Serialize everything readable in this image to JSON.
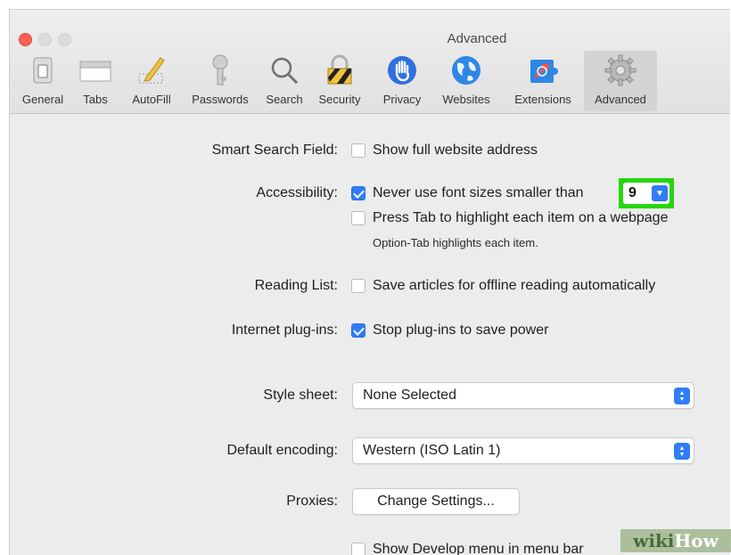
{
  "window": {
    "title": "Advanced"
  },
  "toolbar": {
    "items": [
      {
        "label": "General",
        "icon": "general-switch-icon"
      },
      {
        "label": "Tabs",
        "icon": "tabs-icon"
      },
      {
        "label": "AutoFill",
        "icon": "autofill-pencil-icon"
      },
      {
        "label": "Passwords",
        "icon": "key-icon"
      },
      {
        "label": "Search",
        "icon": "magnifier-icon"
      },
      {
        "label": "Security",
        "icon": "padlock-icon"
      },
      {
        "label": "Privacy",
        "icon": "hand-icon"
      },
      {
        "label": "Websites",
        "icon": "globe-icon"
      },
      {
        "label": "Extensions",
        "icon": "puzzle-icon"
      },
      {
        "label": "Advanced",
        "icon": "gear-icon",
        "selected": true
      }
    ]
  },
  "settings": {
    "smart_search": {
      "label": "Smart Search Field:",
      "option": "Show full website address",
      "checked": false
    },
    "accessibility": {
      "label": "Accessibility:",
      "option_font": "Never use font sizes smaller than",
      "font_checked": true,
      "font_size": "9",
      "option_tab": "Press Tab to highlight each item on a webpage",
      "tab_checked": false,
      "hint": "Option-Tab highlights each item."
    },
    "reading_list": {
      "label": "Reading List:",
      "option": "Save articles for offline reading automatically",
      "checked": false
    },
    "plugins": {
      "label": "Internet plug-ins:",
      "option": "Stop plug-ins to save power",
      "checked": true
    },
    "style_sheet": {
      "label": "Style sheet:",
      "value": "None Selected"
    },
    "encoding": {
      "label": "Default encoding:",
      "value": "Western (ISO Latin 1)"
    },
    "proxies": {
      "label": "Proxies:",
      "button": "Change Settings..."
    },
    "develop": {
      "option": "Show Develop menu in menu bar",
      "checked": false
    }
  },
  "watermark": {
    "text_wiki": "wiki",
    "text_how": "How"
  },
  "colors": {
    "accent": "#2f7cf6",
    "highlight": "#26d60b",
    "close": "#fc5f57"
  }
}
